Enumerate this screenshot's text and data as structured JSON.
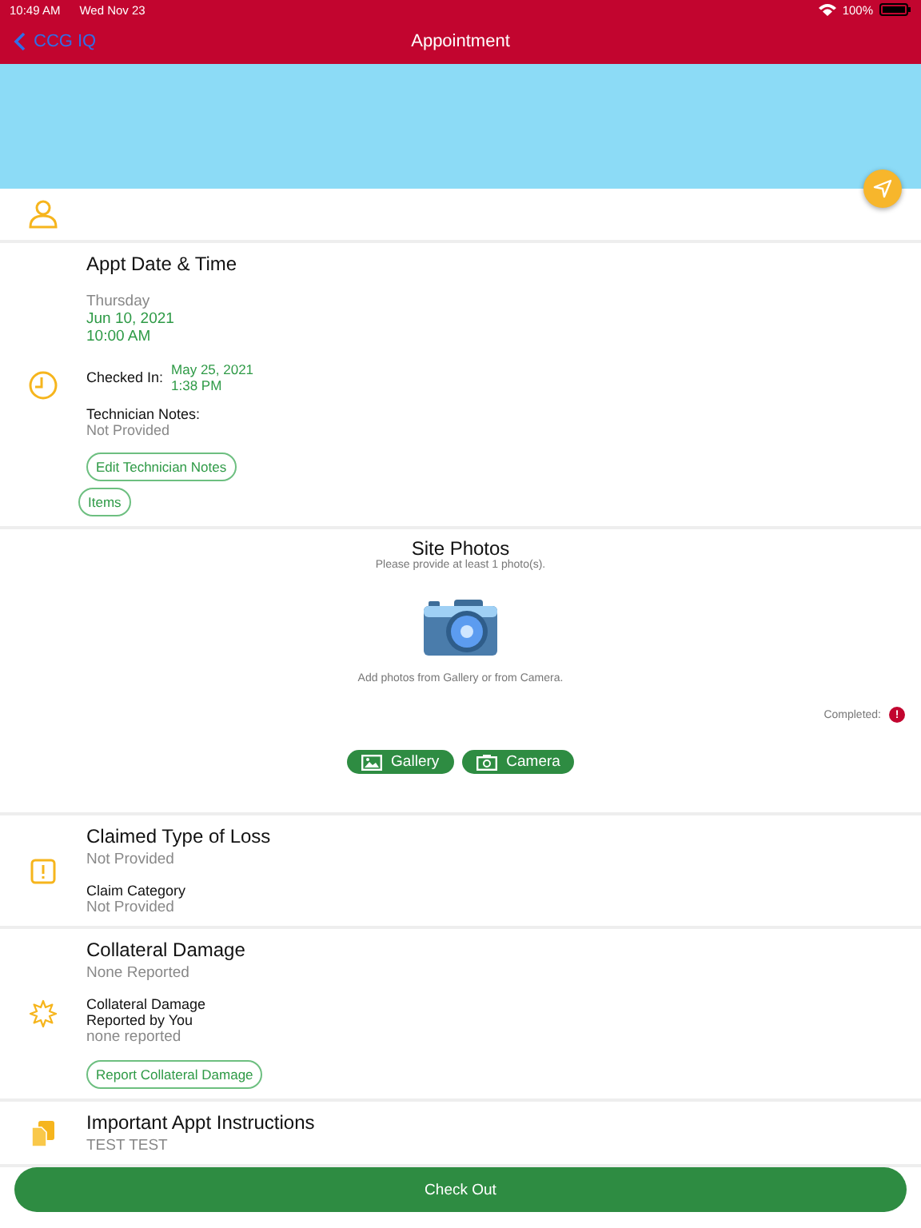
{
  "status_bar": {
    "time": "10:49 AM",
    "date": "Wed Nov 23",
    "battery": "100%"
  },
  "nav": {
    "back": "CCG IQ",
    "title": "Appointment"
  },
  "appt": {
    "title": "Appt Date & Time",
    "weekday": "Thursday",
    "date": "Jun 10, 2021",
    "time": "10:00 AM",
    "checked_in_label": "Checked In:",
    "checked_in_date": "May 25, 2021",
    "checked_in_time": "1:38 PM",
    "notes_label": "Technician Notes:",
    "notes_value": "Not Provided",
    "buttons": [
      "Edit Technician Notes",
      "Items"
    ]
  },
  "photos": {
    "title": "Site Photos",
    "subtitle": "Please provide at least 1 photo(s).",
    "hint": "Add photos from Gallery or from Camera.",
    "completed_label": "Completed:",
    "completed_badge": "!",
    "buttons": [
      {
        "kind": "gallery",
        "label": "Gallery"
      },
      {
        "kind": "camera",
        "label": "Camera"
      }
    ]
  },
  "loss": {
    "title": "Claimed Type of Loss",
    "value": "Not Provided",
    "category_label": "Claim Category",
    "category_value": "Not Provided"
  },
  "collateral": {
    "title": "Collateral Damage",
    "value": "None Reported",
    "you_label_1": "Collateral Damage",
    "you_label_2": "Reported by You",
    "you_value": "none reported",
    "button": "Report Collateral Damage"
  },
  "instructions": {
    "title": "Important Appt Instructions",
    "value": "TEST TEST"
  },
  "check_out": "Check Out"
}
